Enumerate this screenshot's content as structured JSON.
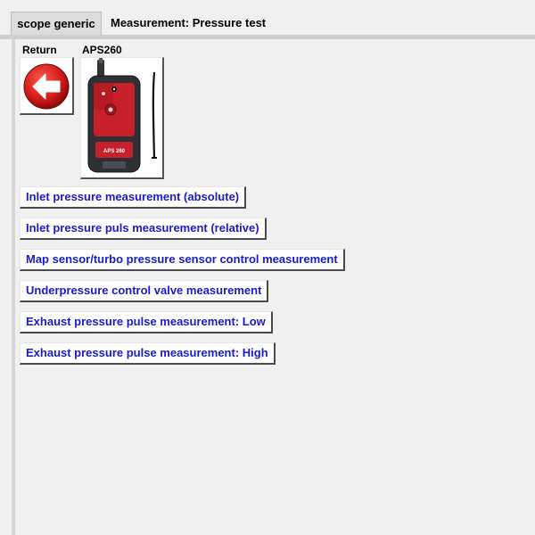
{
  "header": {
    "tab_label": "scope generic",
    "title": "Measurement: Pressure test"
  },
  "tiles": {
    "return_label": "Return",
    "device_label": "APS260",
    "device_logo": "APS 260"
  },
  "measurements": [
    {
      "label": "Inlet pressure measurement (absolute)"
    },
    {
      "label": "Inlet pressure puls measurement (relative)"
    },
    {
      "label": "Map sensor/turbo pressure sensor control measurement"
    },
    {
      "label": "Underpressure control valve measurement"
    },
    {
      "label": "Exhaust pressure pulse measurement: Low"
    },
    {
      "label": "Exhaust pressure pulse measurement: High"
    }
  ],
  "colors": {
    "button_text": "#1a1ad0",
    "return_icon_red": "#d01818",
    "device_red": "#c8202a"
  }
}
